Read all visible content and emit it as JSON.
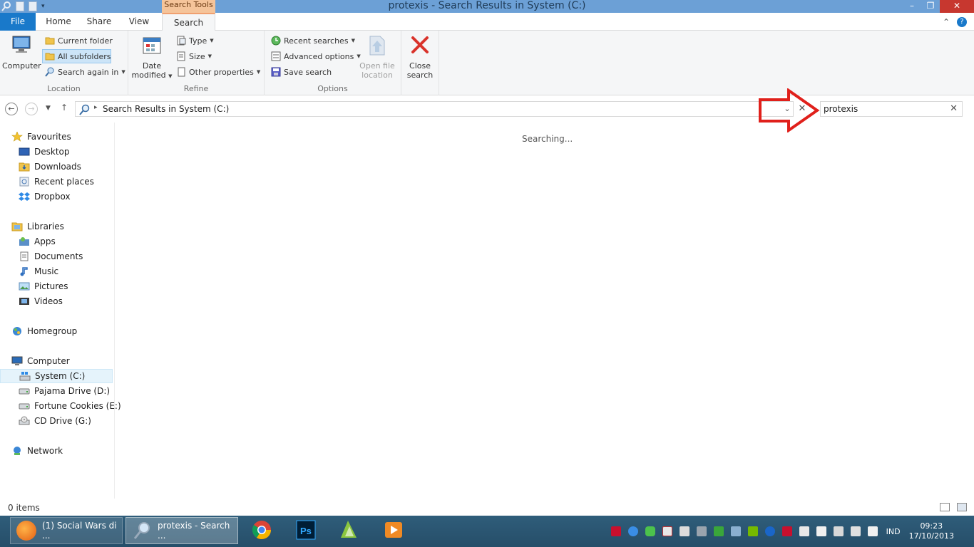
{
  "window": {
    "title": "protexis - Search Results in System (C:)",
    "context_tab": "Search Tools",
    "controls": [
      "minimize",
      "maximize",
      "close"
    ]
  },
  "ribbon_tabs": [
    "File",
    "Home",
    "Share",
    "View",
    "Search"
  ],
  "ribbon": {
    "location": {
      "label": "Location",
      "computer": "Computer",
      "current_folder": "Current folder",
      "all_subfolders": "All subfolders",
      "search_again": "Search again in"
    },
    "refine": {
      "label": "Refine",
      "date_modified_1": "Date",
      "date_modified_2": "modified",
      "type": "Type",
      "size": "Size",
      "other_properties": "Other properties"
    },
    "options": {
      "label": "Options",
      "recent_searches": "Recent searches",
      "advanced_options": "Advanced options",
      "save_search": "Save search",
      "open_file_location_1": "Open file",
      "open_file_location_2": "location"
    },
    "close_search_1": "Close",
    "close_search_2": "search"
  },
  "address": {
    "path": "Search Results in System (C:)",
    "search_value": "protexis"
  },
  "sidebar": {
    "favourites": {
      "label": "Favourites",
      "items": [
        "Desktop",
        "Downloads",
        "Recent places",
        "Dropbox"
      ]
    },
    "libraries": {
      "label": "Libraries",
      "items": [
        "Apps",
        "Documents",
        "Music",
        "Pictures",
        "Videos"
      ]
    },
    "homegroup": "Homegroup",
    "computer": {
      "label": "Computer",
      "items": [
        "System (C:)",
        "Pajama Drive (D:)",
        "Fortune Cookies (E:)",
        "CD Drive (G:)"
      ]
    },
    "network": "Network"
  },
  "content": {
    "status_text": "Searching..."
  },
  "statusbar": {
    "count": "0 items"
  },
  "taskbar": {
    "tasks": [
      "(1) Social Wars di ...",
      "protexis - Search ..."
    ],
    "language": "IND",
    "time": "09:23",
    "date": "17/10/2013"
  },
  "colors": {
    "title_bar": "#6ca0d6",
    "file_tab": "#1979ca",
    "context_tab": "#f5c49a",
    "close_button": "#c7372f",
    "annotation_arrow": "#e0201b",
    "taskbar": "#2f5d7a"
  }
}
